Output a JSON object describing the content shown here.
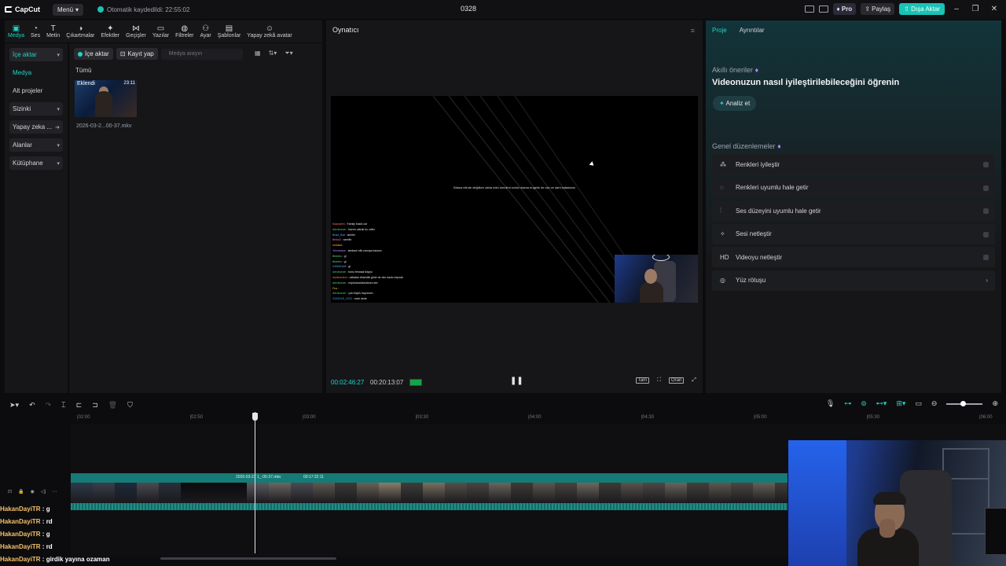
{
  "titlebar": {
    "app_name": "CapCut",
    "menu_label": "Menü",
    "autosave_text": "Otomatik kaydedildi: 22:55:02",
    "project_title": "0328",
    "pro_label": "Pro",
    "share_label": "Paylaş",
    "export_label": "Dışa Aktar"
  },
  "toolbar": {
    "items": [
      {
        "label": "Medya",
        "icon": "media-icon",
        "glyph": "▣",
        "active": true
      },
      {
        "label": "Ses",
        "icon": "audio-icon",
        "glyph": "◔"
      },
      {
        "label": "Metin",
        "icon": "text-icon",
        "glyph": "T"
      },
      {
        "label": "Çıkartmalar",
        "icon": "sticker-icon",
        "glyph": "◑"
      },
      {
        "label": "Efektler",
        "icon": "effects-icon",
        "glyph": "✦"
      },
      {
        "label": "Geçişler",
        "icon": "transitions-icon",
        "glyph": "⋈"
      },
      {
        "label": "Yazılar",
        "icon": "captions-icon",
        "glyph": "▭"
      },
      {
        "label": "Filtreler",
        "icon": "filters-icon",
        "glyph": "◍"
      },
      {
        "label": "Ayar",
        "icon": "adjust-icon",
        "glyph": "⚇"
      },
      {
        "label": "Şablonlar",
        "icon": "templates-icon",
        "glyph": "▤"
      },
      {
        "label": "Yapay zekâ avatar",
        "icon": "ai-avatar-icon",
        "glyph": "☺"
      }
    ]
  },
  "leftnav": {
    "items": [
      {
        "label": "İçe aktar",
        "caret": "▾",
        "style": "sel cyan"
      },
      {
        "label": "Medya",
        "caret": "",
        "style": "sub cyan"
      },
      {
        "label": "Alt projeler",
        "caret": "",
        "style": "sub"
      },
      {
        "label": "Sizinki",
        "caret": "▾",
        "style": "grey"
      },
      {
        "label": "Yapay zeka ...",
        "caret": "➜",
        "style": "grey"
      },
      {
        "label": "Alanlar",
        "caret": "▾",
        "style": "grey"
      },
      {
        "label": "Kütüphane",
        "caret": "▾",
        "style": "grey"
      }
    ]
  },
  "media": {
    "import_label": "İçe aktar",
    "record_label": "Kayıt yap",
    "search_placeholder": "Medya arayın",
    "section_label": "Tümü",
    "clip": {
      "badge": "Eklendi",
      "duration": "23:11",
      "filename": "2026-03-2...00-37.mkv"
    }
  },
  "player": {
    "title": "Oynatıcı",
    "screen_text": "Bilana elinde değilken daha kötü kendimi eziniz daima engelle de sizi ve dahi kafadaniz.",
    "chat_lines": [
      {
        "user": "Kaanakim",
        "text": "Family büsüt car",
        "color": "#f87171"
      },
      {
        "user": "Aeroborum",
        "text": "bazım olarak bu zafer",
        "color": "#4ade80"
      },
      {
        "user": "Buda_Buli",
        "text": "ismiler",
        "color": "#60a5fa"
      },
      {
        "user": "Bedia2",
        "text": "serefin",
        "color": "#f472b6"
      },
      {
        "user": "neddwa",
        "text": "",
        "color": "#fbbf24"
      },
      {
        "user": "Yesmesiçe",
        "text": "iambani elik camışa kasamı",
        "color": "#a78bfa"
      },
      {
        "user": "Bedeko",
        "text": "gl",
        "color": "#4ade80"
      },
      {
        "user": "Bedeko",
        "text": "gl",
        "color": "#4ade80"
      },
      {
        "user": "KARAKUM",
        "text": "gl",
        "color": "#60a5fa"
      },
      {
        "user": "Aeroborum",
        "text": "bonu ferwaal ikiyiyo",
        "color": "#4ade80"
      },
      {
        "user": "tepiskarakul",
        "text": "cakatan biramölk gime ne olur sazlo nepoak",
        "color": "#f87171"
      },
      {
        "user": "Aeroborum",
        "text": "nepöstandüchaksım aht",
        "color": "#4ade80"
      },
      {
        "user": "Fea",
        "text": "",
        "color": "#fbbf24"
      },
      {
        "user": "Aeroborum",
        "text": "çok büyük hayranım",
        "color": "#4ade80"
      },
      {
        "user": "GOOGLE_GCO",
        "text": "erde dede",
        "color": "#60a5fa"
      }
    ],
    "current_time": "00:02:46:27",
    "total_time": "00:20:13:07",
    "ratio_label": "Tam",
    "orig_label": "Oran"
  },
  "details": {
    "tab_project": "Proje",
    "tab_details": "Ayrıntılar",
    "smart_label": "Akıllı öneriler",
    "smart_heading": "Videonuzun nasıl iyileştirilebileceğini öğrenin",
    "analyze_label": "Analiz et",
    "general_title": "Genel düzenlemeler",
    "items": [
      {
        "label": "Renkleri iyileştir",
        "icon": "magic-wand-icon",
        "glyph": "⁂"
      },
      {
        "label": "Renkleri uyumlu hale getir",
        "icon": "color-match-icon",
        "glyph": "◌"
      },
      {
        "label": "Ses düzeyini uyumlu hale getir",
        "icon": "volume-levels-icon",
        "glyph": "⫶"
      },
      {
        "label": "Sesi netleştir",
        "icon": "audio-enhance-icon",
        "glyph": "✧"
      },
      {
        "label": "Videoyu netleştir",
        "icon": "hd-icon",
        "glyph": "HD"
      },
      {
        "label": "Yüz rötuşu",
        "icon": "face-retouch-icon",
        "glyph": "◎"
      }
    ]
  },
  "timeline": {
    "ruler_ticks": [
      "|02:00",
      "|02:50",
      "|03:00",
      "|03:30",
      "|04:00",
      "|04:30",
      "|05:00",
      "|05:30",
      "|06:00"
    ],
    "clip_name": "2026-03-27 1_-00-37.mkv",
    "clip_duration": "00:17:32:11"
  },
  "overlay_chat": [
    {
      "user": "HakanDayiTR",
      "text": " : g"
    },
    {
      "user": "HakanDayiTR",
      "text": " : rd"
    },
    {
      "user": "HakanDayiTR",
      "text": " : g"
    },
    {
      "user": "HakanDayiTR",
      "text": " : rd"
    },
    {
      "user": "HakanDayiTR",
      "text": " : girdik yayına ozaman"
    }
  ],
  "colors": {
    "accent": "#22d3c5",
    "export": "#19c3b5",
    "track": "#167a76",
    "chat_user": "#f5c16c"
  }
}
